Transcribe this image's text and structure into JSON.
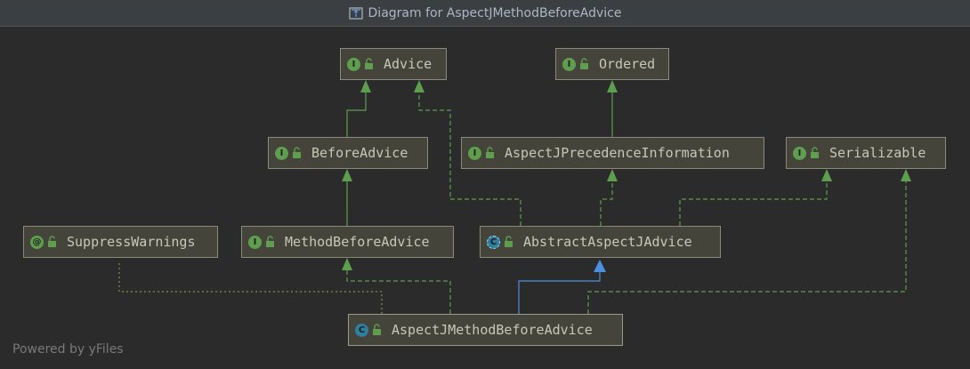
{
  "window": {
    "title": "Diagram for AspectJMethodBeforeAdvice"
  },
  "nodes": {
    "advice": {
      "name": "Advice",
      "kind": "interface",
      "badge": "I"
    },
    "ordered": {
      "name": "Ordered",
      "kind": "interface",
      "badge": "I"
    },
    "before_advice": {
      "name": "BeforeAdvice",
      "kind": "interface",
      "badge": "I"
    },
    "precedence": {
      "name": "AspectJPrecedenceInformation",
      "kind": "interface",
      "badge": "I"
    },
    "serializable": {
      "name": "Serializable",
      "kind": "interface",
      "badge": "I"
    },
    "suppress_warnings": {
      "name": "SuppressWarnings",
      "kind": "annotation",
      "badge": "@"
    },
    "method_before_advice": {
      "name": "MethodBeforeAdvice",
      "kind": "interface",
      "badge": "I"
    },
    "abstract_advice": {
      "name": "AbstractAspectJAdvice",
      "kind": "abstract-class",
      "badge": "C"
    },
    "method_before": {
      "name": "AspectJMethodBeforeAdvice",
      "kind": "class",
      "badge": "C"
    }
  },
  "edges": [
    {
      "from": "before_advice",
      "to": "advice",
      "type": "extends"
    },
    {
      "from": "precedence",
      "to": "ordered",
      "type": "extends"
    },
    {
      "from": "method_before_advice",
      "to": "before_advice",
      "type": "extends"
    },
    {
      "from": "abstract_advice",
      "to": "advice",
      "type": "implements"
    },
    {
      "from": "abstract_advice",
      "to": "precedence",
      "type": "implements"
    },
    {
      "from": "abstract_advice",
      "to": "serializable",
      "type": "implements"
    },
    {
      "from": "method_before",
      "to": "abstract_advice",
      "type": "class-extends"
    },
    {
      "from": "method_before",
      "to": "method_before_advice",
      "type": "implements"
    },
    {
      "from": "method_before",
      "to": "serializable",
      "type": "implements"
    },
    {
      "from": "method_before",
      "to": "suppress_warnings",
      "type": "annotated"
    }
  ],
  "colors": {
    "background": "#2b2b2b",
    "node_fill": "#45443a",
    "extends_edge": "#5e9e4e",
    "class_extends_edge": "#4b8fe0",
    "annotation_edge": "#8a8a50"
  },
  "icons": {
    "title": "diagram-icon",
    "visibility": "lock-open-icon"
  },
  "watermark": "Powered by yFiles"
}
